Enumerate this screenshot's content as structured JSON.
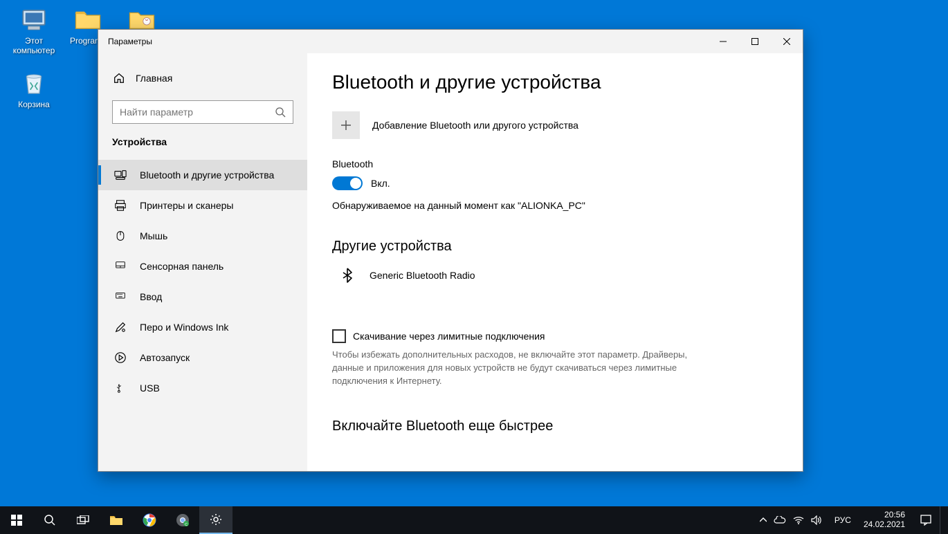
{
  "desktop": {
    "icons": {
      "thispc": "Этот компьютер",
      "programs": "Programs",
      "recycle": "Корзина"
    }
  },
  "window": {
    "title": "Параметры"
  },
  "sidebar": {
    "home": "Главная",
    "search_placeholder": "Найти параметр",
    "section": "Устройства",
    "items": [
      {
        "label": "Bluetooth и другие устройства"
      },
      {
        "label": "Принтеры и сканеры"
      },
      {
        "label": "Мышь"
      },
      {
        "label": "Сенсорная панель"
      },
      {
        "label": "Ввод"
      },
      {
        "label": "Перо и Windows Ink"
      },
      {
        "label": "Автозапуск"
      },
      {
        "label": "USB"
      }
    ]
  },
  "main": {
    "title": "Bluetooth и другие устройства",
    "add_device": "Добавление Bluetooth или другого устройства",
    "bt_label": "Bluetooth",
    "toggle_state": "Вкл.",
    "discoverable": "Обнаруживаемое на данный момент как \"ALIONKA_PC\"",
    "other_devices_h": "Другие устройства",
    "device1": "Generic Bluetooth Radio",
    "metered_check": "Скачивание через лимитные подключения",
    "metered_help": "Чтобы избежать дополнительных расходов, не включайте этот параметр. Драйверы, данные и приложения для новых устройств не будут скачиваться через лимитные подключения к Интернету.",
    "promo_h": "Включайте Bluetooth еще быстрее"
  },
  "taskbar": {
    "lang": "РУС",
    "time": "20:56",
    "date": "24.02.2021"
  }
}
